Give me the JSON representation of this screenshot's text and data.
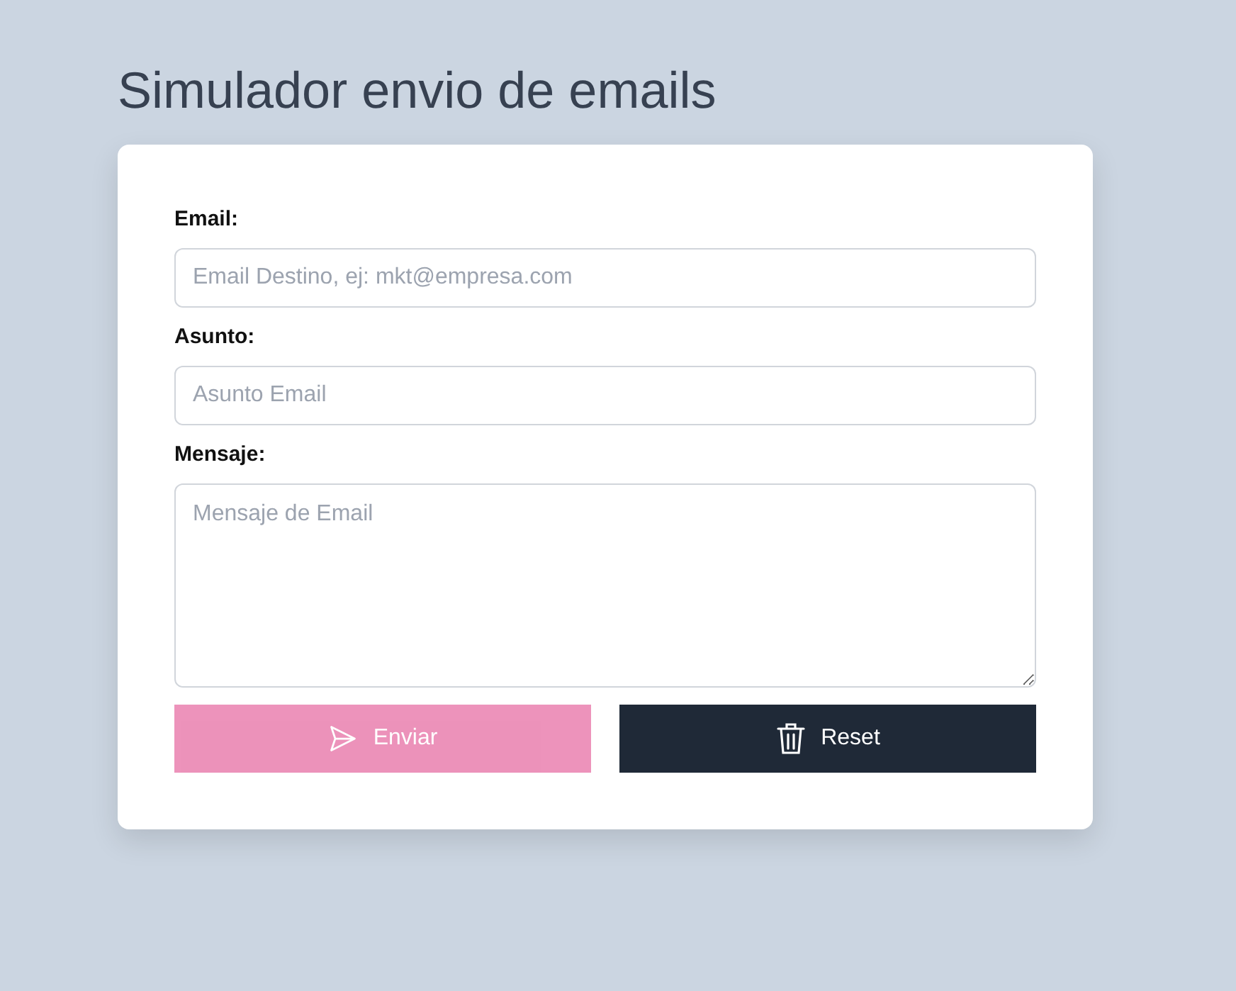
{
  "title": "Simulador envio de emails",
  "fields": [
    {
      "label": "Email:",
      "placeholder": "Email Destino, ej: mkt@empresa.com",
      "kind": "input"
    },
    {
      "label": "Asunto:",
      "placeholder": "Asunto Email",
      "kind": "input"
    },
    {
      "label": "Mensaje:",
      "placeholder": "Mensaje de Email",
      "kind": "textarea"
    }
  ],
  "buttons": [
    {
      "label": "Enviar",
      "kind": "send",
      "disabled": true
    },
    {
      "label": "Reset",
      "kind": "reset",
      "disabled": false
    }
  ]
}
